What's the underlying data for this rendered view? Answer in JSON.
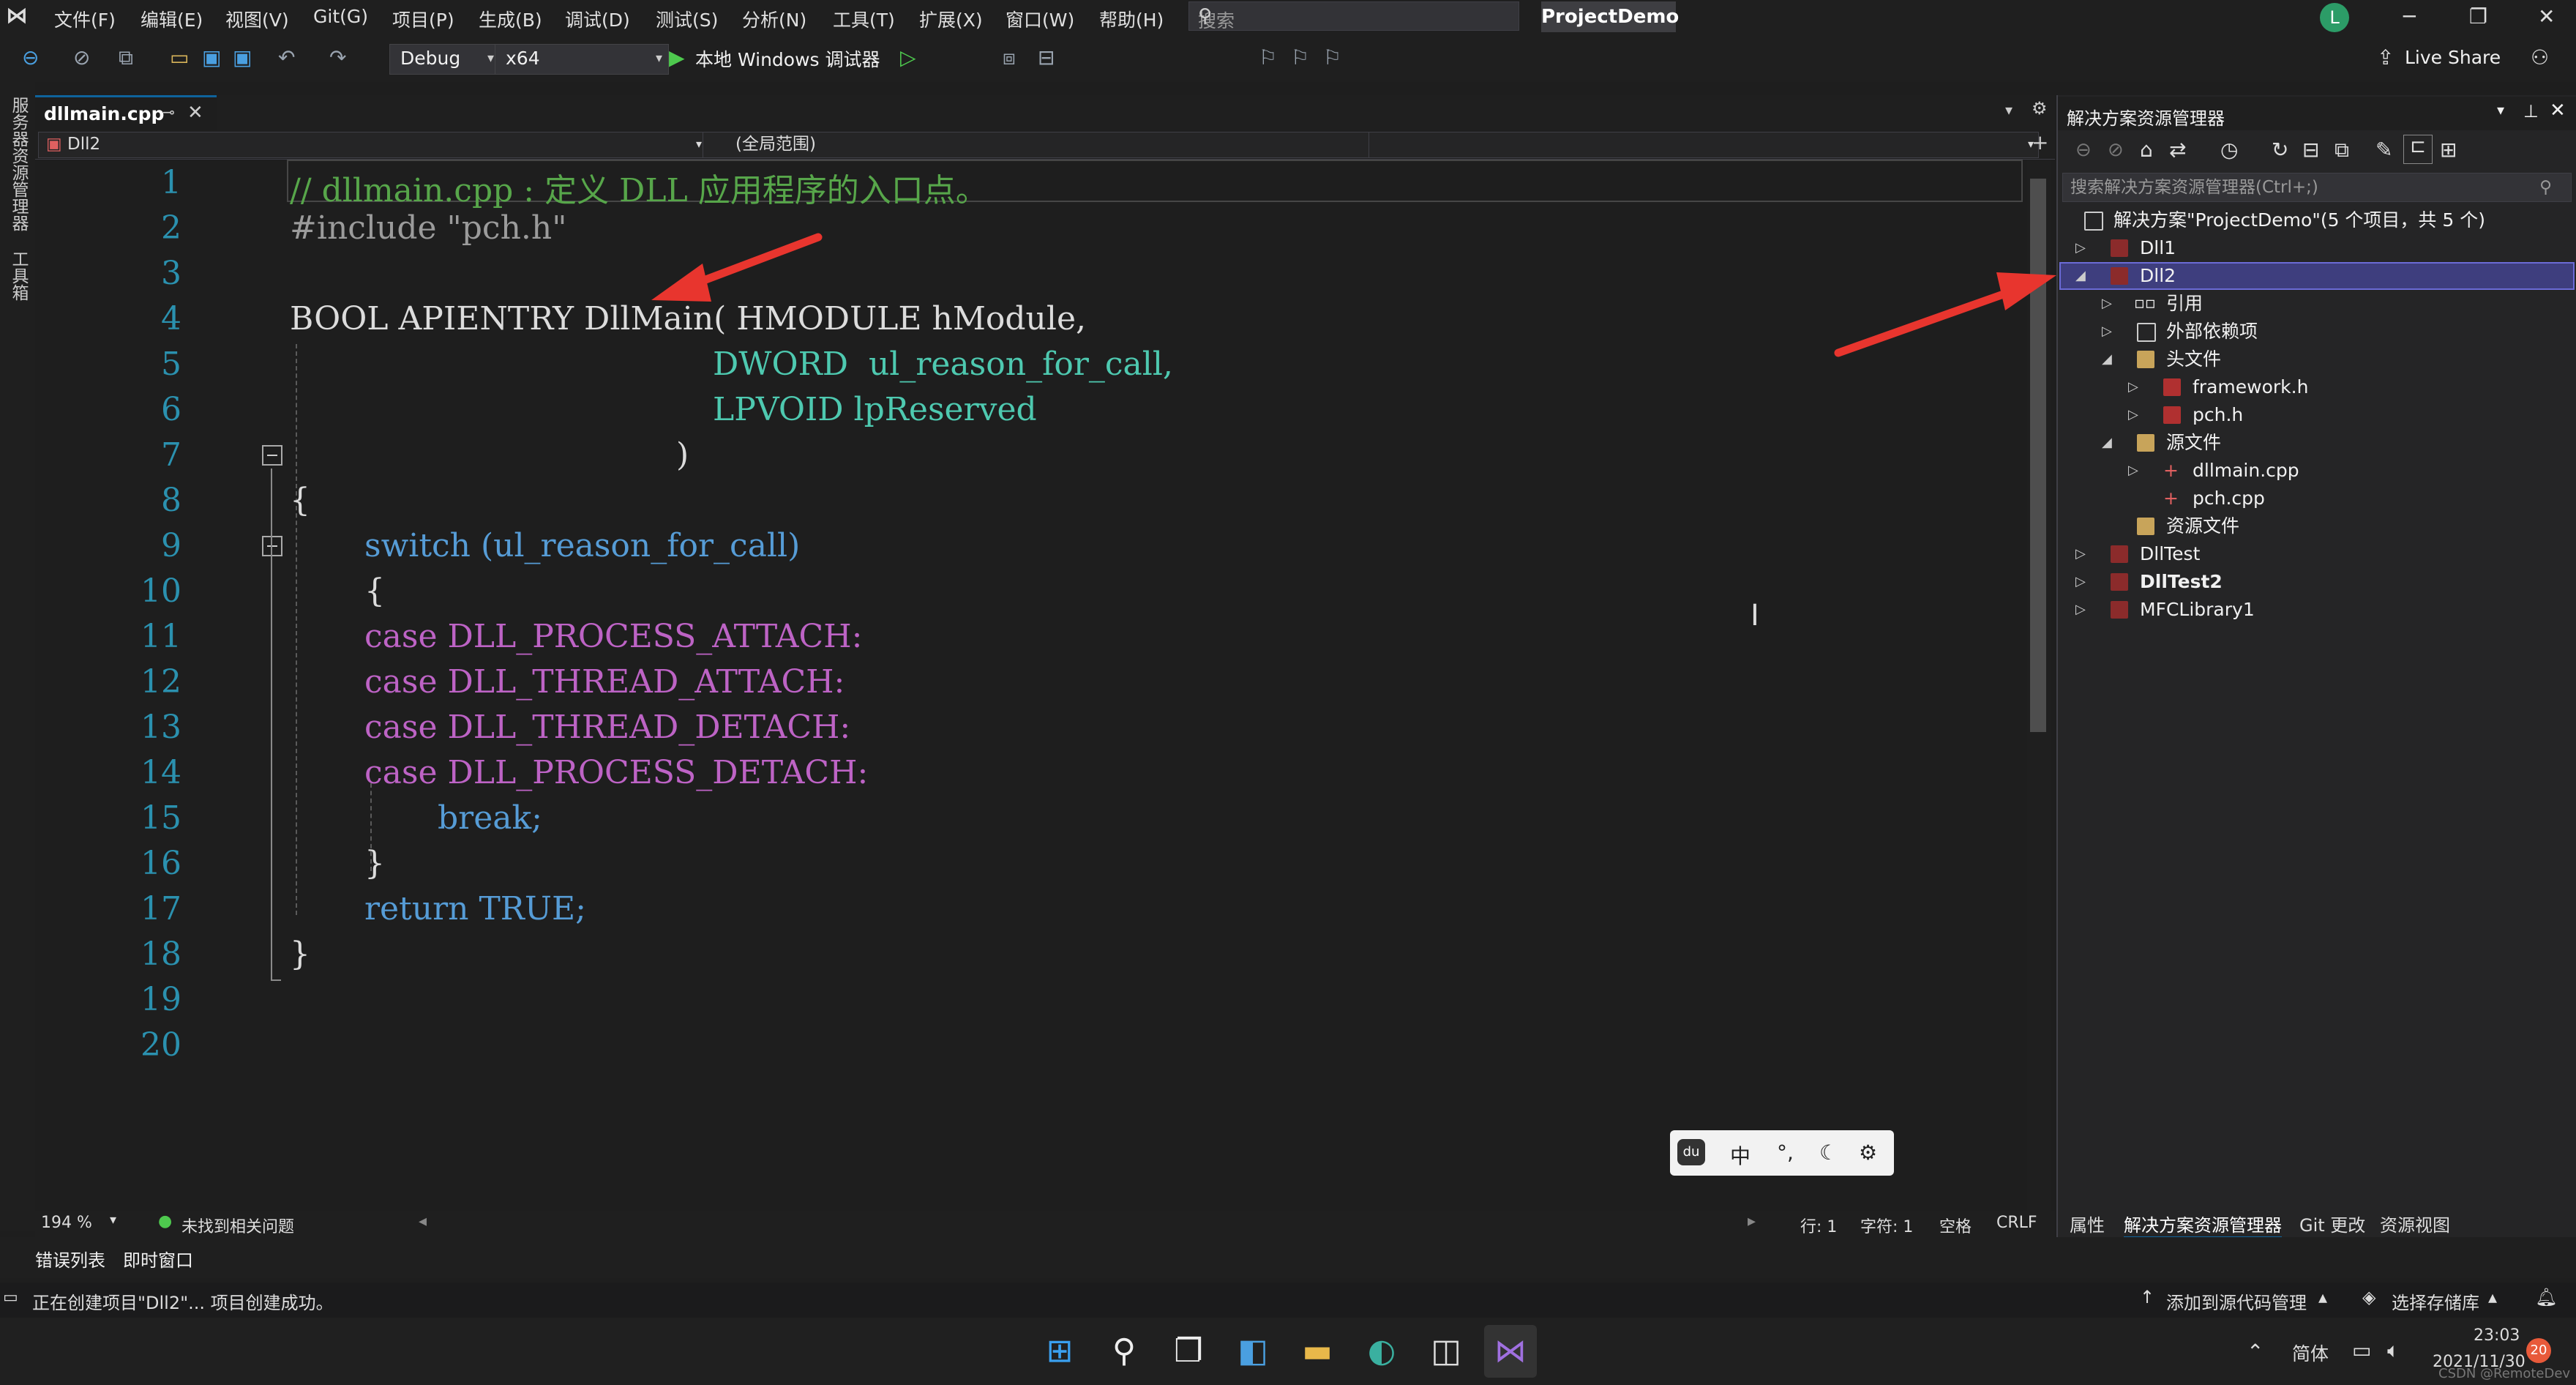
{
  "menu": [
    "文件(F)",
    "编辑(E)",
    "视图(V)",
    "Git(G)",
    "项目(P)",
    "生成(B)",
    "调试(D)",
    "测试(S)",
    "分析(N)",
    "工具(T)",
    "扩展(X)",
    "窗口(W)",
    "帮助(H)"
  ],
  "search": {
    "placeholder": "搜索"
  },
  "project_name": "ProjectDemo",
  "user_initial": "L",
  "toolbar": {
    "config": "Debug",
    "platform": "x64",
    "run_label": "本地 Windows 调试器",
    "live_share": "Live Share"
  },
  "left_strip": {
    "server_explorer": "服务器资源管理器",
    "toolbox": "工具箱"
  },
  "editor": {
    "tab": "dllmain.cpp",
    "scope_project": "Dll2",
    "scope_global": "(全局范围)",
    "lines": [
      {
        "n": "1",
        "text": "// dllmain.cpp : 定义 DLL 应用程序的入口点。"
      },
      {
        "n": "2",
        "text": "#include \"pch.h\""
      },
      {
        "n": "3",
        "text": ""
      },
      {
        "n": "4",
        "text": "BOOL APIENTRY DllMain( HMODULE hModule,"
      },
      {
        "n": "5",
        "text": "DWORD  ul_reason_for_call,"
      },
      {
        "n": "6",
        "text": "LPVOID lpReserved"
      },
      {
        "n": "7",
        "text": ")"
      },
      {
        "n": "8",
        "text": "{"
      },
      {
        "n": "9",
        "text": "switch (ul_reason_for_call)"
      },
      {
        "n": "10",
        "text": "{"
      },
      {
        "n": "11",
        "text": "case DLL_PROCESS_ATTACH:"
      },
      {
        "n": "12",
        "text": "case DLL_THREAD_ATTACH:"
      },
      {
        "n": "13",
        "text": "case DLL_THREAD_DETACH:"
      },
      {
        "n": "14",
        "text": "case DLL_PROCESS_DETACH:"
      },
      {
        "n": "15",
        "text": "break;"
      },
      {
        "n": "16",
        "text": "}"
      },
      {
        "n": "17",
        "text": "return TRUE;"
      },
      {
        "n": "18",
        "text": "}"
      },
      {
        "n": "19",
        "text": ""
      },
      {
        "n": "20",
        "text": ""
      }
    ],
    "zoom": "194 %",
    "issues": "未找到相关问题",
    "line_col": "行: 1",
    "char_col": "字符: 1",
    "whitespace": "空格",
    "eol": "CRLF"
  },
  "solution_explorer": {
    "title": "解决方案资源管理器",
    "search_placeholder": "搜索解决方案资源管理器(Ctrl+;)",
    "solution": "解决方案\"ProjectDemo\"(5 个项目，共 5 个)",
    "items": [
      {
        "label": "Dll1"
      },
      {
        "label": "Dll2"
      },
      {
        "label": "引用"
      },
      {
        "label": "外部依赖项"
      },
      {
        "label": "头文件"
      },
      {
        "label": "framework.h"
      },
      {
        "label": "pch.h"
      },
      {
        "label": "源文件"
      },
      {
        "label": "dllmain.cpp"
      },
      {
        "label": "pch.cpp"
      },
      {
        "label": "资源文件"
      },
      {
        "label": "DllTest"
      },
      {
        "label": "DllTest2"
      },
      {
        "label": "MFCLibrary1"
      }
    ],
    "bottom_tabs": [
      "属性",
      "解决方案资源管理器",
      "Git 更改",
      "资源视图"
    ]
  },
  "bottom_tabs": [
    "错误列表",
    "即时窗口"
  ],
  "status": {
    "message": "正在创建项目\"Dll2\"... 项目创建成功。",
    "add_source": "添加到源代码管理",
    "select_repo": "选择存储库"
  },
  "ime": {
    "mode": "中",
    "punct": "°,"
  },
  "taskbar": {
    "lang": "简体",
    "time": "23:03",
    "date": "2021/11/30",
    "badge": "20",
    "watermark": "CSDN @RemoteDev"
  },
  "colors": {
    "accent": "#0e639c",
    "selection": "#3e3e7e",
    "keyword": "#569cd6",
    "type": "#4ec9b0",
    "comment": "#57a64a",
    "linenumber": "#2b91af",
    "arrow": "#e8352e"
  }
}
